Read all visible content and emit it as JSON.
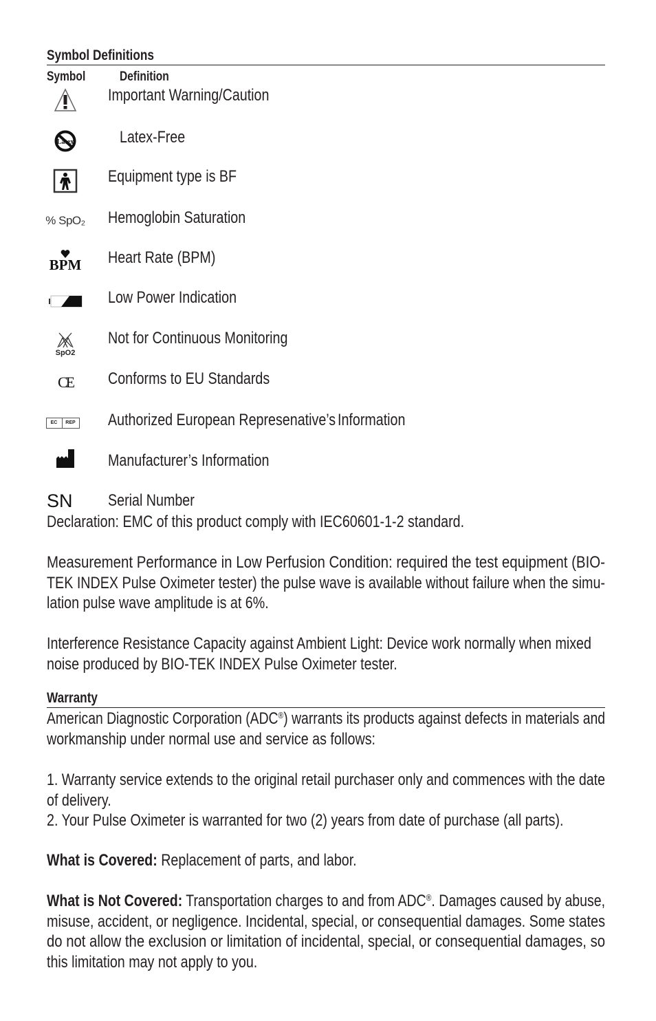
{
  "symbol_definitions": {
    "title": "Symbol Definitions",
    "col_symbol": "Symbol",
    "col_definition": "Definition",
    "items": [
      {
        "icon": "warning-triangle-icon",
        "label": "Important Warning/Caution"
      },
      {
        "icon": "latex-free-icon",
        "label": "Latex-Free"
      },
      {
        "icon": "type-bf-icon",
        "label": "Equipment type is BF"
      },
      {
        "icon": "spo2-icon",
        "icon_text": "% SpO₂",
        "label": "Hemoglobin Saturation"
      },
      {
        "icon": "bpm-heart-icon",
        "icon_text": "BPM",
        "label": "Heart Rate (BPM)"
      },
      {
        "icon": "low-battery-icon",
        "label": "Low Power Indication"
      },
      {
        "icon": "not-continuous-monitoring-icon",
        "icon_text": "SpO2",
        "label": "Not for Continuous Monitoring"
      },
      {
        "icon": "ce-mark-icon",
        "icon_text": "CE",
        "label": "Conforms to EU Standards"
      },
      {
        "icon": "ec-rep-icon",
        "icon_text_left": "EC",
        "icon_text_right": "REP",
        "label": "Authorized European Represenative’s",
        "label_extra": "Information"
      },
      {
        "icon": "manufacturer-icon",
        "label": "Manufacturer’s Information"
      },
      {
        "icon": "serial-number-icon",
        "icon_text": "SN",
        "label": "Serial Number"
      }
    ]
  },
  "declaration": "Declaration: EMC of this product comply with IEC60601-1-2 standard.",
  "low_perfusion": {
    "lines": [
      "Measurement Performance in Low Perfusion Condition: required the test equipment (BIO-",
      "TEK INDEX Pulse Oximeter tester) the pulse wave is available without failure when the simu-",
      "lation pulse wave amplitude is at 6%."
    ]
  },
  "ambient_light": {
    "lines": [
      "Interference Resistance Capacity against Ambient Light: Device work normally when mixed",
      "noise produced by BIO-TEK INDEX Pulse Oximeter tester."
    ]
  },
  "warranty": {
    "title": "Warranty",
    "intro_line1_a": "American Diagnostic Corporation (ADC",
    "reg": "®",
    "intro_line1_b": ") warrants its products against defects in materials and",
    "intro_line2": "workmanship under normal use and service as follows:",
    "terms": [
      "1. Warranty service extends to the original retail purchaser only and commences with the date",
      "of delivery.",
      "2. Your Pulse Oximeter is warranted for two (2) years from date of purchase (all parts)."
    ],
    "covered_label": "What is Covered:",
    "covered_text": " Replacement of parts, and labor.",
    "not_covered_label": "What is Not Covered:",
    "not_covered_line1_a": " Transportation charges to and from ADC",
    "not_covered_line1_b": ". Damages caused by abuse,",
    "not_covered_lines": [
      "misuse, accident, or negligence. Incidental, special, or consequential damages. Some states",
      "do not allow the exclusion or limitation of incidental, special, or consequential damages, so",
      "this limitation may not apply to you."
    ]
  }
}
